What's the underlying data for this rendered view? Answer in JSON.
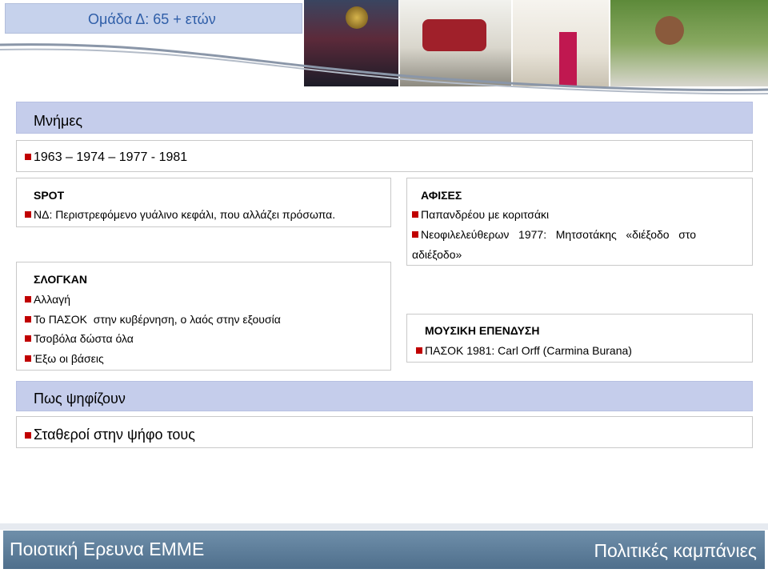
{
  "header": {
    "title": "Ομάδα Δ: 65 + ετών"
  },
  "memories": {
    "title": "Μνήμες",
    "years": "1963 – 1974 – 1977 - 1981"
  },
  "spot": {
    "title": "SPOT",
    "items": [
      "ΝΔ: Περιστρεφόμενο γυάλινο κεφάλι, που αλλάζει πρόσωπα."
    ]
  },
  "posters": {
    "title": "ΑΦΙΣΕΣ",
    "items": [
      "Παπανδρέου με κοριτσάκι",
      "Νεοφιλελεύθερων   1977:   Μητσοτάκης   «διέξοδο   στο",
      "αδιέξοδο»"
    ]
  },
  "slogans": {
    "title": "ΣΛΟΓΚΑΝ",
    "items": [
      "Αλλαγή",
      "Το ΠΑΣΟΚ  στην κυβέρνηση, ο λαός στην εξουσία",
      "Τσοβόλα δώστα όλα",
      "Έξω οι βάσεις"
    ]
  },
  "music": {
    "title": "ΜΟΥΣΙΚΗ ΕΠΕΝΔΥΣΗ",
    "items": [
      "ΠΑΣΟΚ 1981: Carl Orff (Carmina Burana)"
    ]
  },
  "voting": {
    "title": "Πως ψηφίζουν",
    "items": [
      "Σταθεροί στην ψήφο τους"
    ]
  },
  "footer": {
    "left": "Ποιοτική Ερευνα ΕΜΜΕ",
    "right": "Πολιτικές καμπάνιες"
  },
  "colors": {
    "accent": "#c5cdeb",
    "bullet": "#c00000",
    "title_text": "#2f5ea8",
    "footer": "#5a7a96"
  }
}
